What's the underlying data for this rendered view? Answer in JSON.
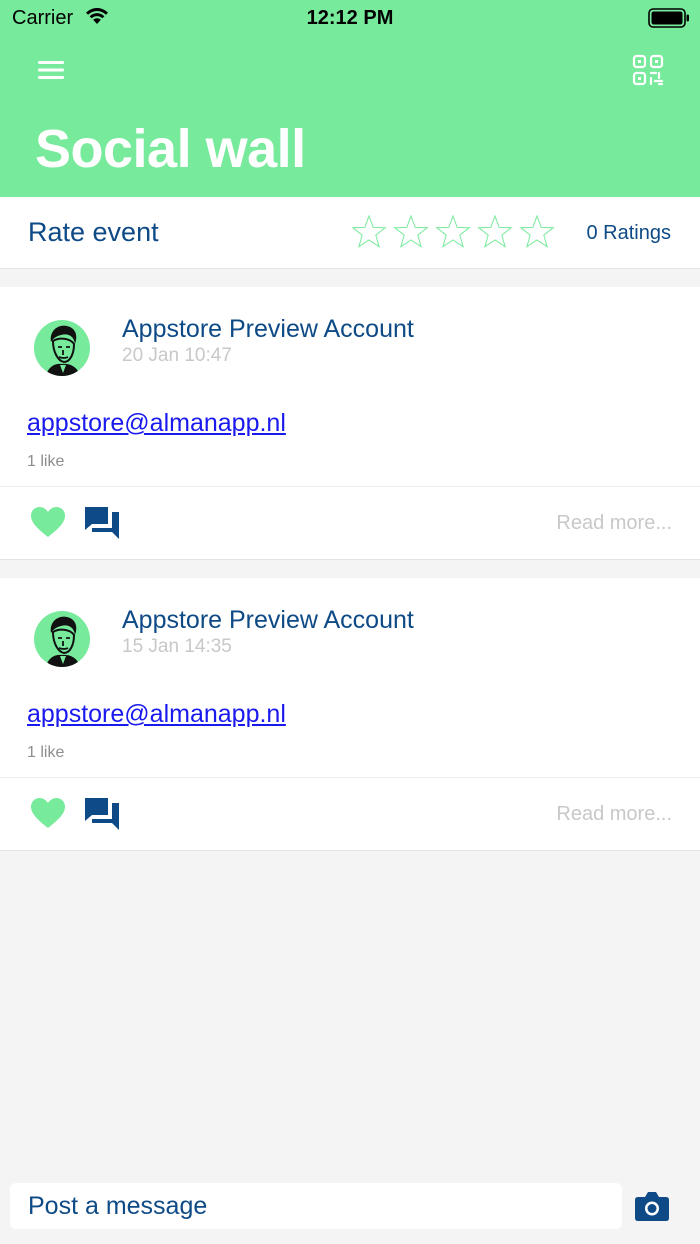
{
  "status_bar": {
    "carrier": "Carrier",
    "time": "12:12 PM"
  },
  "header": {
    "title": "Social wall",
    "menu_icon": "hamburger-menu-icon",
    "qr_icon": "qr-code-icon"
  },
  "rating": {
    "label": "Rate event",
    "stars_total": 5,
    "stars_filled": 0,
    "count_label": "0 Ratings"
  },
  "posts": [
    {
      "author": "Appstore Preview Account",
      "time": "20 Jan 10:47",
      "link": "appstore@almanapp.nl",
      "likes": "1 like",
      "read_more": "Read more..."
    },
    {
      "author": "Appstore Preview Account",
      "time": "15 Jan 14:35",
      "link": "appstore@almanapp.nl",
      "likes": "1 like",
      "read_more": "Read more..."
    }
  ],
  "composer": {
    "placeholder": "Post a message",
    "camera_icon": "camera-icon"
  },
  "colors": {
    "accent": "#78ea9c",
    "primary_text": "#0d4a86",
    "link": "#1a1aee",
    "muted": "#c8c8c8",
    "background": "#f4f4f4"
  }
}
